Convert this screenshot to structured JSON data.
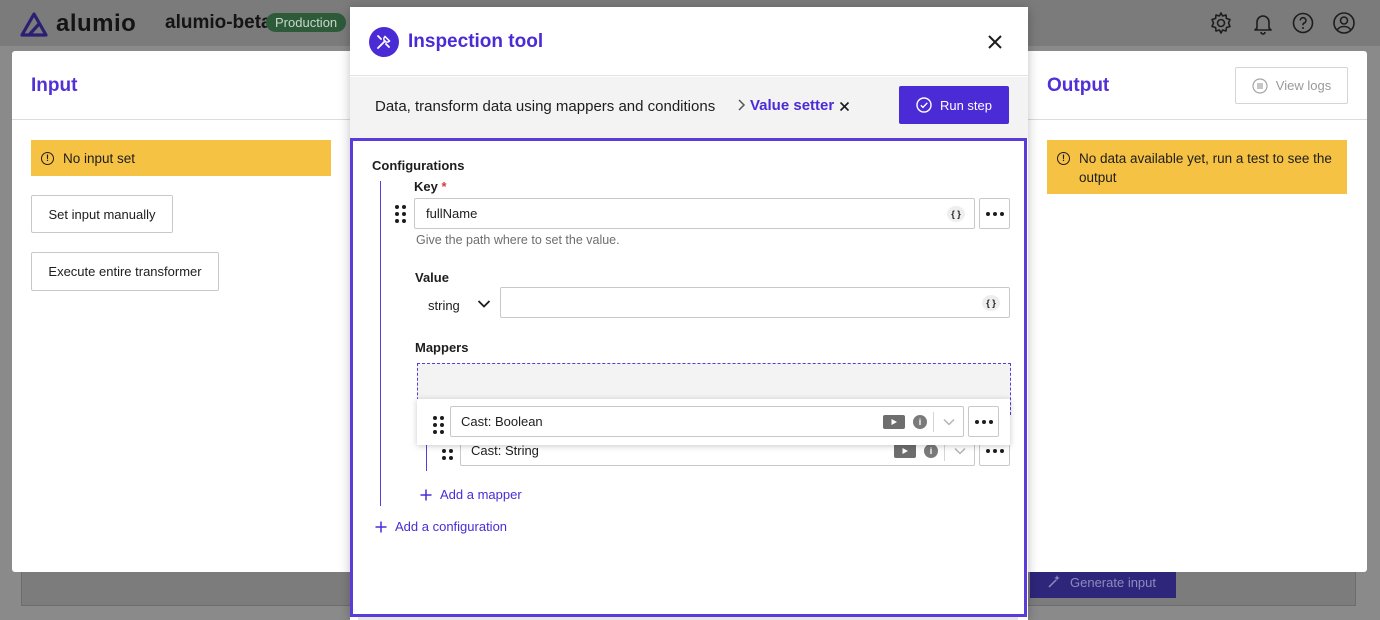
{
  "app": {
    "logo_text": "alumio",
    "env_name": "alumio-beta",
    "env_badge": "Production"
  },
  "header_icons": [
    "gear-icon",
    "bell-icon",
    "help-icon",
    "user-icon"
  ],
  "input_panel": {
    "title": "Input",
    "warning": "No input set",
    "set_input_label": "Set input manually",
    "execute_label": "Execute entire transformer"
  },
  "output_panel": {
    "title": "Output",
    "view_logs_label": "View logs",
    "warning": "No data available yet, run a test to see the output"
  },
  "background": {
    "generate_input_label": "Generate input"
  },
  "modal": {
    "title": "Inspection tool",
    "breadcrumb": {
      "parent": "Data, transform data using mappers and conditions",
      "active": "Value setter"
    },
    "run_step_label": "Run step",
    "configurations_label": "Configurations",
    "key": {
      "label": "Key",
      "required_mark": "*",
      "value": "fullName",
      "helper": "Give the path where to set the value."
    },
    "value": {
      "label": "Value",
      "type": "string",
      "value": ""
    },
    "mappers": {
      "label": "Mappers",
      "items": [
        {
          "label": "Cast: Boolean",
          "dragging": true
        },
        {
          "label": "Cast: String",
          "dragging": false
        }
      ],
      "add_label": "Add a mapper"
    },
    "add_configuration_label": "Add a configuration"
  },
  "colors": {
    "accent": "#4b2bd6",
    "warning": "#f6c243",
    "badge_green": "#2d5b3a"
  }
}
